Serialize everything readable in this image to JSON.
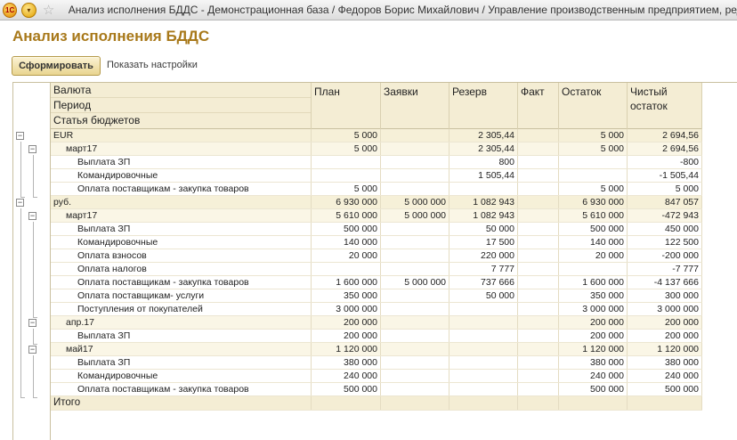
{
  "window": {
    "title": "Анализ исполнения БДДС - Демонстрационная база / Федоров Борис Михайлович / Управление производственным предприятием, редакция"
  },
  "page": {
    "title": "Анализ исполнения БДДС",
    "form_button": "Сформировать",
    "settings_link": "Показать настройки"
  },
  "table": {
    "header": {
      "row_group_1": "Валюта",
      "row_group_2": "Период",
      "row_group_3": "Статья бюджетов",
      "plan": "План",
      "zayavki": "Заявки",
      "rezerv": "Резерв",
      "fakt": "Факт",
      "ostatok": "Остаток",
      "chisty": "Чистый остаток"
    },
    "rows": [
      {
        "level": 0,
        "name": "EUR",
        "plan": "5 000",
        "zayavki": "",
        "rezerv": "2 305,44",
        "fakt": "",
        "ostatok": "5 000",
        "chisty": "2 694,56"
      },
      {
        "level": 1,
        "name": "март17",
        "plan": "5 000",
        "zayavki": "",
        "rezerv": "2 305,44",
        "fakt": "",
        "ostatok": "5 000",
        "chisty": "2 694,56"
      },
      {
        "level": 2,
        "name": "Выплата ЗП",
        "plan": "",
        "zayavki": "",
        "rezerv": "800",
        "fakt": "",
        "ostatok": "",
        "chisty": "-800"
      },
      {
        "level": 2,
        "name": "Командировочные",
        "plan": "",
        "zayavki": "",
        "rezerv": "1 505,44",
        "fakt": "",
        "ostatok": "",
        "chisty": "-1 505,44"
      },
      {
        "level": 2,
        "name": "Оплата поставщикам - закупка товаров",
        "plan": "5 000",
        "zayavki": "",
        "rezerv": "",
        "fakt": "",
        "ostatok": "5 000",
        "chisty": "5 000"
      },
      {
        "level": 0,
        "name": "руб.",
        "plan": "6 930 000",
        "zayavki": "5 000 000",
        "rezerv": "1 082 943",
        "fakt": "",
        "ostatok": "6 930 000",
        "chisty": "847 057"
      },
      {
        "level": 1,
        "name": "март17",
        "plan": "5 610 000",
        "zayavki": "5 000 000",
        "rezerv": "1 082 943",
        "fakt": "",
        "ostatok": "5 610 000",
        "chisty": "-472 943"
      },
      {
        "level": 2,
        "name": "Выплата ЗП",
        "plan": "500 000",
        "zayavki": "",
        "rezerv": "50 000",
        "fakt": "",
        "ostatok": "500 000",
        "chisty": "450 000"
      },
      {
        "level": 2,
        "name": "Командировочные",
        "plan": "140 000",
        "zayavki": "",
        "rezerv": "17 500",
        "fakt": "",
        "ostatok": "140 000",
        "chisty": "122 500"
      },
      {
        "level": 2,
        "name": "Оплата взносов",
        "plan": "20 000",
        "zayavki": "",
        "rezerv": "220 000",
        "fakt": "",
        "ostatok": "20 000",
        "chisty": "-200 000"
      },
      {
        "level": 2,
        "name": "Оплата налогов",
        "plan": "",
        "zayavki": "",
        "rezerv": "7 777",
        "fakt": "",
        "ostatok": "",
        "chisty": "-7 777"
      },
      {
        "level": 2,
        "name": "Оплата поставщикам - закупка товаров",
        "plan": "1 600 000",
        "zayavki": "5 000 000",
        "rezerv": "737 666",
        "fakt": "",
        "ostatok": "1 600 000",
        "chisty": "-4 137 666"
      },
      {
        "level": 2,
        "name": "Оплата поставщикам- услуги",
        "plan": "350 000",
        "zayavki": "",
        "rezerv": "50 000",
        "fakt": "",
        "ostatok": "350 000",
        "chisty": "300 000"
      },
      {
        "level": 2,
        "name": "Поступления от покупателей",
        "plan": "3 000 000",
        "zayavki": "",
        "rezerv": "",
        "fakt": "",
        "ostatok": "3 000 000",
        "chisty": "3 000 000"
      },
      {
        "level": 1,
        "name": "апр.17",
        "plan": "200 000",
        "zayavki": "",
        "rezerv": "",
        "fakt": "",
        "ostatok": "200 000",
        "chisty": "200 000"
      },
      {
        "level": 2,
        "name": "Выплата ЗП",
        "plan": "200 000",
        "zayavki": "",
        "rezerv": "",
        "fakt": "",
        "ostatok": "200 000",
        "chisty": "200 000"
      },
      {
        "level": 1,
        "name": "май17",
        "plan": "1 120 000",
        "zayavki": "",
        "rezerv": "",
        "fakt": "",
        "ostatok": "1 120 000",
        "chisty": "1 120 000"
      },
      {
        "level": 2,
        "name": "Выплата ЗП",
        "plan": "380 000",
        "zayavki": "",
        "rezerv": "",
        "fakt": "",
        "ostatok": "380 000",
        "chisty": "380 000"
      },
      {
        "level": 2,
        "name": "Командировочные",
        "plan": "240 000",
        "zayavki": "",
        "rezerv": "",
        "fakt": "",
        "ostatok": "240 000",
        "chisty": "240 000"
      },
      {
        "level": 2,
        "name": "Оплата поставщикам - закупка товаров",
        "plan": "500 000",
        "zayavki": "",
        "rezerv": "",
        "fakt": "",
        "ostatok": "500 000",
        "chisty": "500 000"
      }
    ],
    "total_label": "Итого"
  }
}
